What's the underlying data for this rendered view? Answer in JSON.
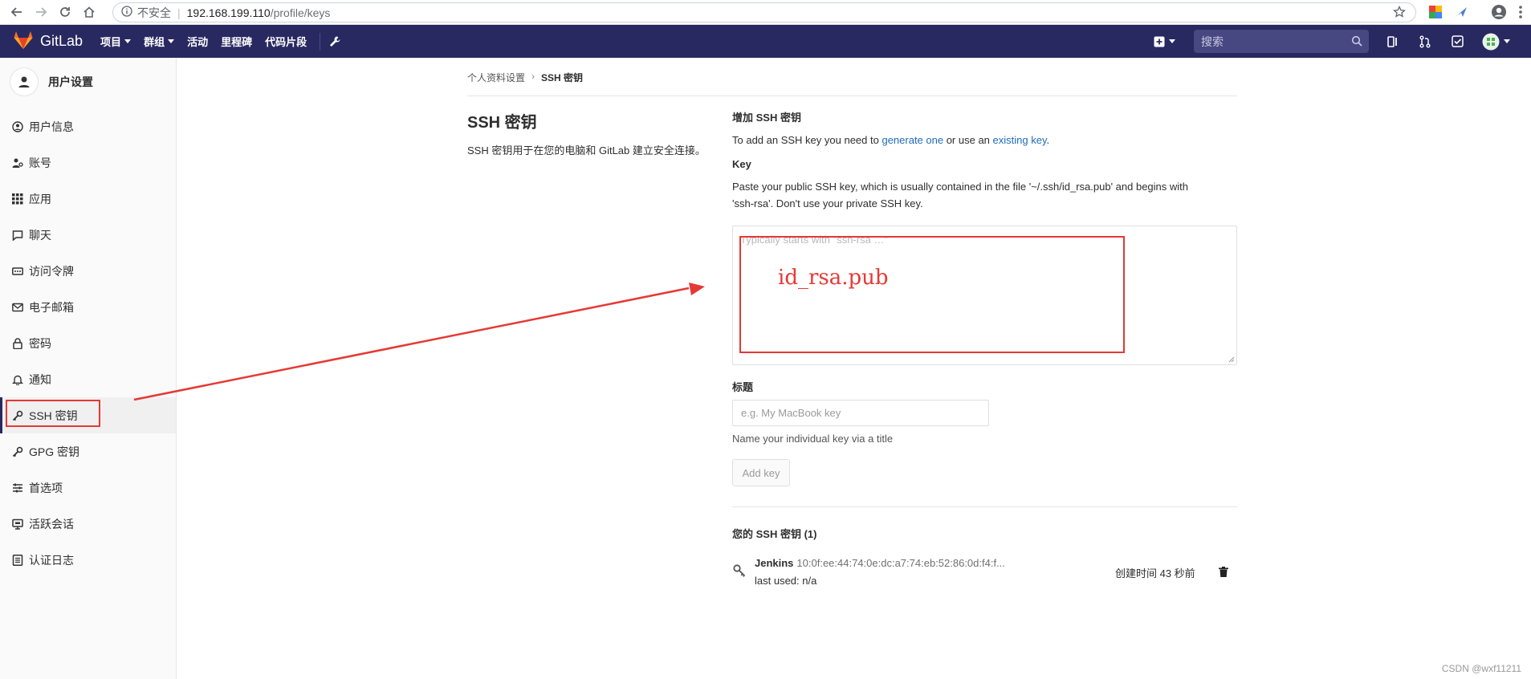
{
  "browser": {
    "security_label": "不安全",
    "url_host": "192.168.199.110",
    "url_path": "/profile/keys"
  },
  "header": {
    "logo_text": "GitLab",
    "menu": [
      {
        "label": "项目",
        "has_caret": true
      },
      {
        "label": "群组",
        "has_caret": true
      },
      {
        "label": "活动",
        "has_caret": false
      },
      {
        "label": "里程碑",
        "has_caret": false
      },
      {
        "label": "代码片段",
        "has_caret": false
      }
    ],
    "search_placeholder": "搜索"
  },
  "sidebar": {
    "title": "用户设置",
    "items": [
      {
        "label": "用户信息",
        "icon": "user-icon"
      },
      {
        "label": "账号",
        "icon": "account-icon"
      },
      {
        "label": "应用",
        "icon": "applications-icon"
      },
      {
        "label": "聊天",
        "icon": "chat-icon"
      },
      {
        "label": "访问令牌",
        "icon": "token-icon"
      },
      {
        "label": "电子邮箱",
        "icon": "mail-icon"
      },
      {
        "label": "密码",
        "icon": "lock-icon"
      },
      {
        "label": "通知",
        "icon": "bell-icon"
      },
      {
        "label": "SSH 密钥",
        "icon": "key-icon",
        "active": true
      },
      {
        "label": "GPG 密钥",
        "icon": "gpg-key-icon"
      },
      {
        "label": "首选项",
        "icon": "preferences-icon"
      },
      {
        "label": "活跃会话",
        "icon": "sessions-icon"
      },
      {
        "label": "认证日志",
        "icon": "log-icon"
      }
    ]
  },
  "breadcrumb": {
    "parent": "个人资料设置",
    "current": "SSH 密钥"
  },
  "left_panel": {
    "heading": "SSH 密钥",
    "description": "SSH 密钥用于在您的电脑和 GitLab 建立安全连接。"
  },
  "form": {
    "add_heading": "增加 SSH 密钥",
    "intro_prefix": "To add an SSH key you need to ",
    "intro_link1": "generate one",
    "intro_middle": " or use an ",
    "intro_link2": "existing key",
    "intro_suffix": ".",
    "key_label": "Key",
    "key_help_line1": "Paste your public SSH key, which is usually contained in the file '~/.ssh/id_rsa.pub' and begins with",
    "key_help_line2": "'ssh-rsa'. Don't use your private SSH key.",
    "key_placeholder": "Typically starts with \"ssh-rsa …\"",
    "annotation_text": "id_rsa.pub",
    "title_label": "标题",
    "title_placeholder": "e.g. My MacBook key",
    "title_help": "Name your individual key via a title",
    "add_button": "Add key"
  },
  "keys": {
    "heading": "您的 SSH 密钥 (1)",
    "list": [
      {
        "name": "Jenkins",
        "fingerprint": "10:0f:ee:44:74:0e:dc:a7:74:eb:52:86:0d:f4:f...",
        "last_used": "last used: n/a",
        "created": "创建时间 43 秒前"
      }
    ]
  },
  "watermark": "CSDN @wxf11211",
  "colors": {
    "header_bg": "#292961",
    "annotation_red": "#e53935",
    "link_blue": "#1f6bb8"
  }
}
